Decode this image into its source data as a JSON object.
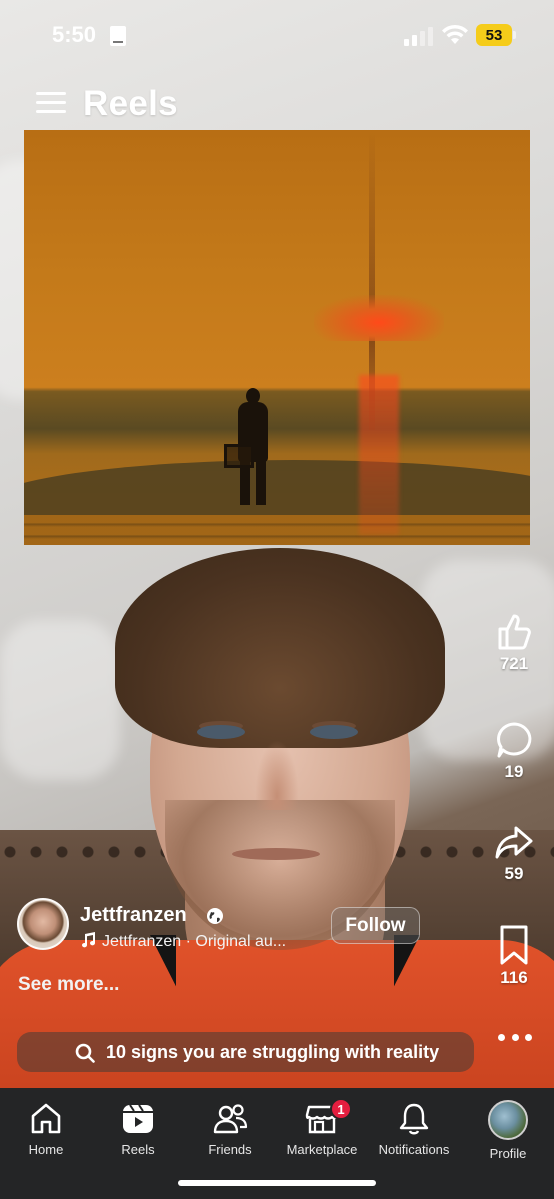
{
  "status_bar": {
    "time": "5:50",
    "battery": "53"
  },
  "header": {
    "title": "Reels"
  },
  "actions": {
    "likes": "721",
    "comments": "19",
    "shares": "59",
    "saves": "116"
  },
  "author": {
    "name": "Jettfranzen",
    "audio": "Jettfranzen · Original au...",
    "follow_label": "Follow",
    "see_more": "See more..."
  },
  "search": {
    "text": "10 signs you are struggling with reality"
  },
  "nav": {
    "home": "Home",
    "reels": "Reels",
    "friends": "Friends",
    "marketplace": "Marketplace",
    "marketplace_badge": "1",
    "notifications": "Notifications",
    "profile": "Profile"
  },
  "colors": {
    "nav_bg": "#242526",
    "badge": "#e41e3f",
    "battery": "#f5cc1a"
  }
}
